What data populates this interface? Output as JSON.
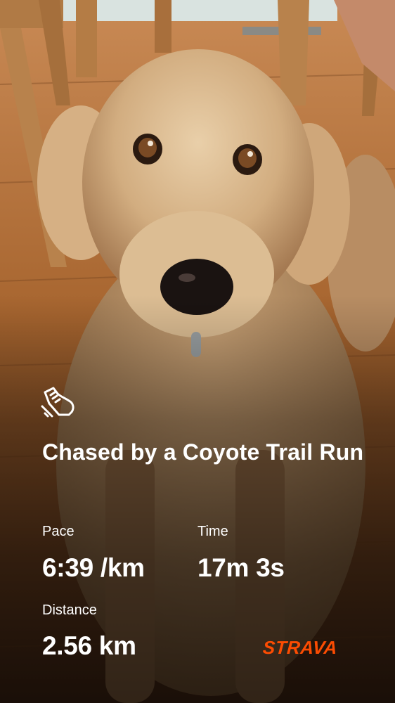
{
  "activity": {
    "icon": "running-shoe-icon",
    "title": "Chased by a Coyote Trail Run"
  },
  "stats": {
    "pace": {
      "label": "Pace",
      "value": "6:39 /km"
    },
    "time": {
      "label": "Time",
      "value": "17m 3s"
    },
    "distance": {
      "label": "Distance",
      "value": "2.56 km"
    }
  },
  "brand": {
    "name": "STRAVA",
    "color": "#fc4c02"
  },
  "colors": {
    "text": "#ffffff",
    "floor": "#9c5d2c",
    "dog_fur": "#d8b68c"
  }
}
